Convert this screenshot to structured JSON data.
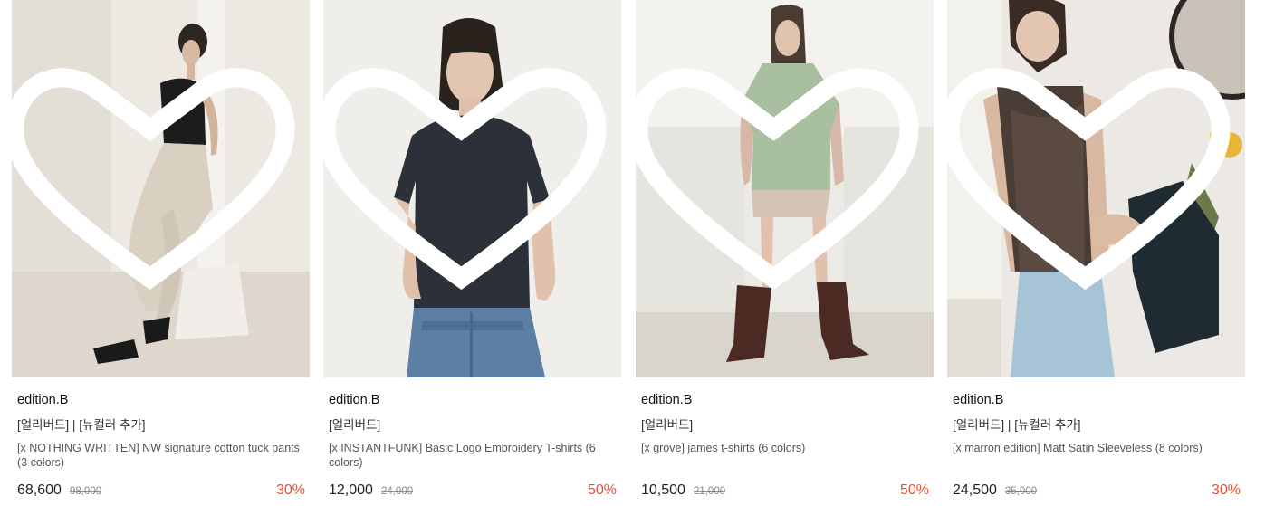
{
  "products": [
    {
      "brand": "edition.B",
      "tags": "[얼리버드] | [뉴컬러 추가]",
      "name": "[x NOTHING WRITTEN] NW signature cotton tuck pants (3 colors)",
      "price": "68,600",
      "original_price": "98,000",
      "discount": "30%",
      "image": "model-black-tank-beige-pants"
    },
    {
      "brand": "edition.B",
      "tags": "[얼리버드]",
      "name": "[x INSTANTFUNK] Basic Logo Embroidery T-shirts (6 colors)",
      "price": "12,000",
      "original_price": "24,000",
      "discount": "50%",
      "image": "model-navy-tshirt-jeans"
    },
    {
      "brand": "edition.B",
      "tags": "[얼리버드]",
      "name": "[x grove] james t-shirts (6 colors)",
      "price": "10,500",
      "original_price": "21,000",
      "discount": "50%",
      "image": "model-mint-tshirt-boots"
    },
    {
      "brand": "edition.B",
      "tags": "[얼리버드] | [뉴컬러 추가]",
      "name": "[x marron edition] Matt Satin Sleeveless (8 colors)",
      "price": "24,500",
      "original_price": "35,000",
      "discount": "30%",
      "image": "model-brown-satin-camisole"
    }
  ],
  "colors": {
    "discount": "#ee4d2d",
    "price": "#222222",
    "original_price": "#8a8a8a"
  }
}
